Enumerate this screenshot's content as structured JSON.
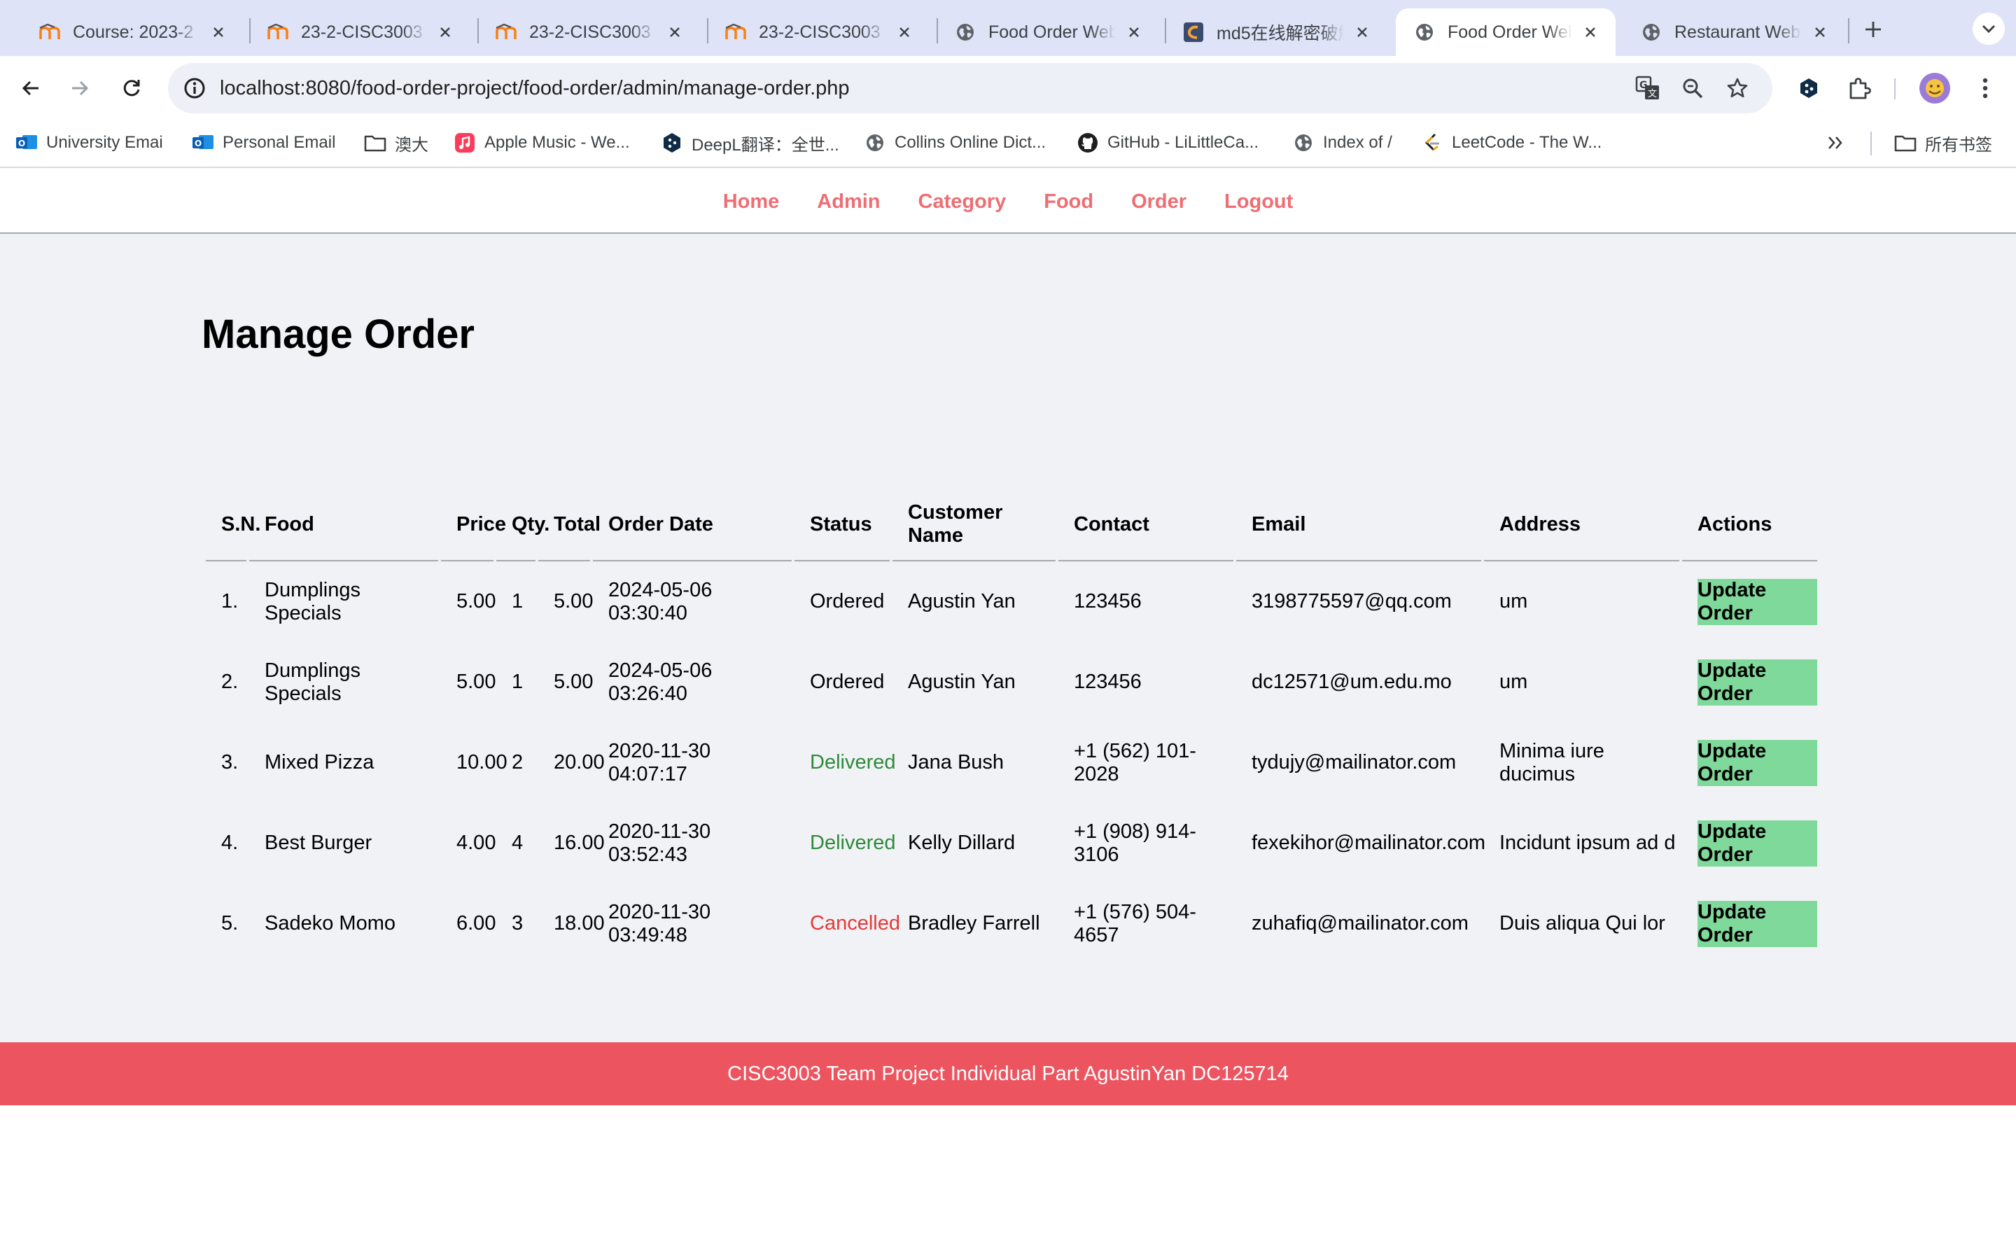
{
  "browser": {
    "tabs": [
      {
        "title": "Course: 2023-2",
        "favicon": "moodle-icon"
      },
      {
        "title": "23-2-CISC3003",
        "favicon": "moodle-icon"
      },
      {
        "title": "23-2-CISC3003",
        "favicon": "moodle-icon"
      },
      {
        "title": "23-2-CISC3003",
        "favicon": "moodle-icon"
      },
      {
        "title": "Food Order Web",
        "favicon": "globe-icon"
      },
      {
        "title": "md5在线解密破解",
        "favicon": "md5-site-icon"
      },
      {
        "title": "Food Order Web",
        "favicon": "globe-icon",
        "active": true
      },
      {
        "title": "Restaurant Web",
        "favicon": "globe-icon"
      }
    ],
    "url": "localhost:8080/food-order-project/food-order/admin/manage-order.php",
    "bookmarks": [
      {
        "label": "University Emai",
        "icon": "outlook-icon"
      },
      {
        "label": "Personal Email",
        "icon": "outlook-icon"
      },
      {
        "label": "澳大",
        "icon": "folder-icon"
      },
      {
        "label": "Apple Music - We...",
        "icon": "music-icon"
      },
      {
        "label": "DeepL翻译：全世...",
        "icon": "deepl-icon"
      },
      {
        "label": "Collins Online Dict...",
        "icon": "globe-icon"
      },
      {
        "label": "GitHub - LiLittleCa...",
        "icon": "github-icon"
      },
      {
        "label": "Index of /",
        "icon": "globe-icon"
      },
      {
        "label": "LeetCode - The W...",
        "icon": "leetcode-icon"
      }
    ],
    "all_bookmarks": "所有书签"
  },
  "menu": {
    "items": [
      "Home",
      "Admin",
      "Category",
      "Food",
      "Order",
      "Logout"
    ]
  },
  "main": {
    "title": "Manage Order",
    "columns": [
      "S.N.",
      "Food",
      "Price",
      "Qty.",
      "Total",
      "Order Date",
      "Status",
      "Customer Name",
      "Contact",
      "Email",
      "Address",
      "Actions"
    ],
    "orders": [
      {
        "sn": "1.",
        "food": "Dumplings Specials",
        "price": "5.00",
        "qty": "1",
        "total": "5.00",
        "date": "2024-05-06 03:30:40",
        "status": "Ordered",
        "customer": "Agustin Yan",
        "contact": "123456",
        "email": "3198775597@qq.com",
        "address": "um",
        "action": "Update Order"
      },
      {
        "sn": "2.",
        "food": "Dumplings Specials",
        "price": "5.00",
        "qty": "1",
        "total": "5.00",
        "date": "2024-05-06 03:26:40",
        "status": "Ordered",
        "customer": "Agustin Yan",
        "contact": "123456",
        "email": "dc12571@um.edu.mo",
        "address": "um",
        "action": "Update Order"
      },
      {
        "sn": "3.",
        "food": "Mixed Pizza",
        "price": "10.00",
        "qty": "2",
        "total": "20.00",
        "date": "2020-11-30 04:07:17",
        "status": "Delivered",
        "customer": "Jana Bush",
        "contact": "+1 (562) 101-2028",
        "email": "tydujy@mailinator.com",
        "address": "Minima iure ducimus",
        "action": "Update Order"
      },
      {
        "sn": "4.",
        "food": "Best Burger",
        "price": "4.00",
        "qty": "4",
        "total": "16.00",
        "date": "2020-11-30 03:52:43",
        "status": "Delivered",
        "customer": "Kelly Dillard",
        "contact": "+1 (908) 914-3106",
        "email": "fexekihor@mailinator.com",
        "address": "Incidunt ipsum ad d",
        "action": "Update Order"
      },
      {
        "sn": "5.",
        "food": "Sadeko Momo",
        "price": "6.00",
        "qty": "3",
        "total": "18.00",
        "date": "2020-11-30 03:49:48",
        "status": "Cancelled",
        "customer": "Bradley Farrell",
        "contact": "+1 (576) 504-4657",
        "email": "zuhafiq@mailinator.com",
        "address": "Duis aliqua Qui lor",
        "action": "Update Order"
      }
    ]
  },
  "footer": {
    "text": "CISC3003 Team Project Individual Part AgustinYan DC125714"
  },
  "colors": {
    "menu_link": "#ee6e73",
    "footer_bg": "#ec5560",
    "delivered": "#2d8a3a",
    "cancelled": "#e53935",
    "update_btn_bg": "#7ed99a"
  }
}
